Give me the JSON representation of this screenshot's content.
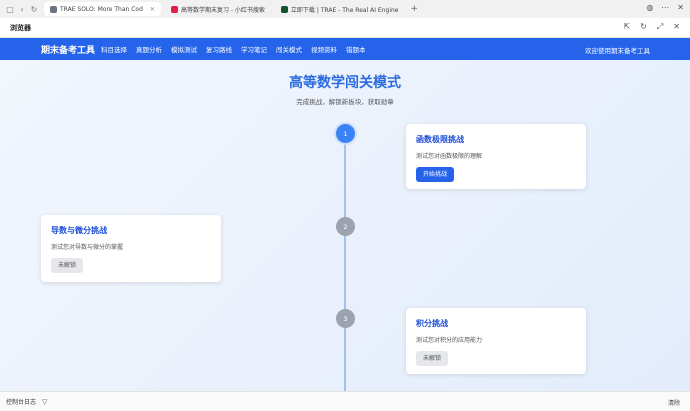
{
  "browser": {
    "tabs": [
      {
        "label": "TRAE SOLO: More Than Cod",
        "color": "#6b7280",
        "active": true
      },
      {
        "label": "高等数学期末复习 - 小红书搜索",
        "color": "#e11d48",
        "active": false
      },
      {
        "label": "立即下载 | TRAE - The Real AI Engine",
        "color": "#14532d",
        "active": false
      }
    ],
    "window_title": "浏览器"
  },
  "app": {
    "brand": "期末备考工具",
    "nav": [
      "科目选择",
      "真题分析",
      "模拟测试",
      "复习路线",
      "学习笔记",
      "闯关模式",
      "视频资料",
      "错题本"
    ],
    "welcome": "欢迎使用期末备考工具"
  },
  "hero": {
    "title": "高等数学闯关模式",
    "subtitle": "完成挑战，解锁新板块，获取勋章"
  },
  "levels": [
    {
      "num": "1",
      "title": "函数极限挑战",
      "desc": "测试您对函数极限的理解",
      "button": "开始挑战",
      "unlocked": true
    },
    {
      "num": "2",
      "title": "导数与微分挑战",
      "desc": "测试您对导数与微分的掌握",
      "button": "未解锁",
      "unlocked": false
    },
    {
      "num": "3",
      "title": "积分挑战",
      "desc": "测试您对积分的应用能力",
      "button": "未解锁",
      "unlocked": false
    }
  ],
  "bottom": {
    "console_label": "控制台日志",
    "right_label": "清除"
  },
  "colors": {
    "primary": "#2563eb",
    "locked_node": "#9ca3af"
  }
}
